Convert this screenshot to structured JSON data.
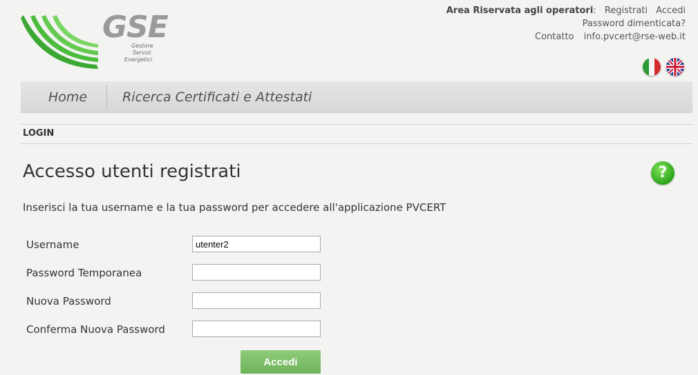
{
  "logo": {
    "name": "GSE",
    "sub1": "Gestore",
    "sub2": "Servizi",
    "sub3": "Energetici"
  },
  "topbar": {
    "area_label": "Area Riservata agli operatori",
    "colon": ":",
    "register_label": "Registrati",
    "login_label": "Accedi",
    "forgot_label": "Password dimenticata?",
    "contact_label": "Contatto",
    "contact_email": "info.pvcert@rse-web.it"
  },
  "languages": [
    {
      "name": "italian-flag-icon"
    },
    {
      "name": "uk-flag-icon"
    }
  ],
  "nav": {
    "home": "Home",
    "search": "Ricerca Certificati e Attestati"
  },
  "section": "LOGIN",
  "page_title": "Accesso utenti registrati",
  "help_icon": "?",
  "intro": "Inserisci la tua username e la tua password per accedere all'applicazione PVCERT",
  "form": {
    "username_label": "Username",
    "username_value": "utenter2",
    "temp_password_label": "Password Temporanea",
    "temp_password_value": "",
    "new_password_label": "Nuova Password",
    "new_password_value": "",
    "confirm_password_label": "Conferma Nuova Password",
    "confirm_password_value": "",
    "submit_label": "Accedi"
  },
  "colors": {
    "accent_green": "#6fb35a",
    "logo_green": "#2ea41b"
  }
}
